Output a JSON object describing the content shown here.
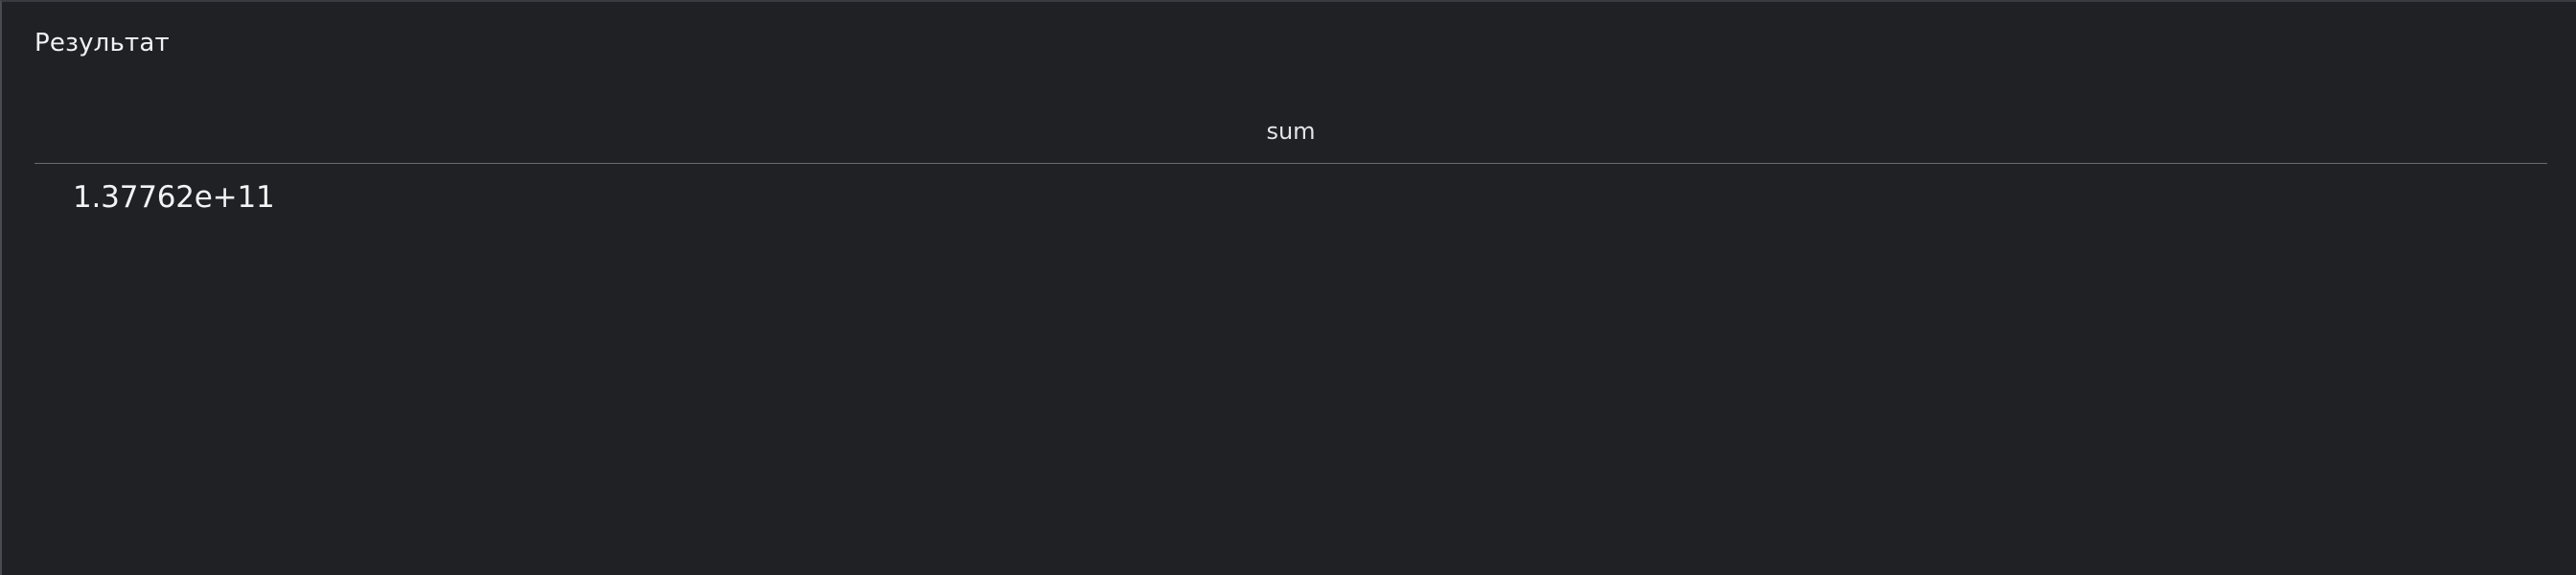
{
  "panel": {
    "title": "Результат"
  },
  "table": {
    "columns": [
      {
        "label": "sum"
      }
    ],
    "rows": [
      {
        "sum": "1.37762e+11"
      }
    ]
  }
}
